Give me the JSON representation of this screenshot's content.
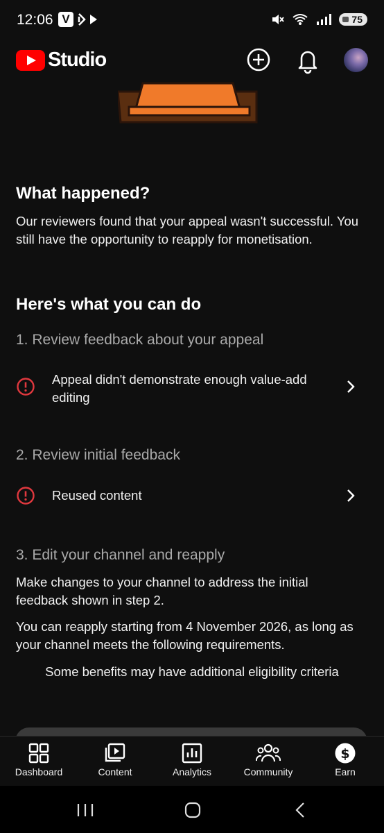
{
  "status_bar": {
    "time": "12:06",
    "battery": "75"
  },
  "app_bar": {
    "title": "Studio"
  },
  "what_happened": {
    "heading": "What happened?",
    "body": "Our reviewers found that your appeal wasn't successful. You still have the opportunity to reapply for monetisation."
  },
  "what_to_do": {
    "heading": "Here's what you can do",
    "step1": {
      "title": "1. Review feedback about your appeal",
      "item": "Appeal didn't demonstrate enough value-add editing"
    },
    "step2": {
      "title": "2. Review initial feedback",
      "item": "Reused content"
    },
    "step3": {
      "title": "3. Edit your channel and reapply",
      "para1": "Make changes to your channel to address the initial feedback shown in step 2.",
      "para2": "You can reapply starting from 4 November 2026, as long as your channel meets the following requirements.",
      "note": "Some benefits may have additional eligibility criteria"
    }
  },
  "bottom_nav": [
    {
      "label": "Dashboard",
      "icon": "dashboard-icon"
    },
    {
      "label": "Content",
      "icon": "content-icon"
    },
    {
      "label": "Analytics",
      "icon": "analytics-icon"
    },
    {
      "label": "Community",
      "icon": "community-icon"
    },
    {
      "label": "Earn",
      "icon": "earn-icon"
    }
  ],
  "colors": {
    "background": "#0f0f0f",
    "brand_red": "#ff0000",
    "alert_red": "#e0383e",
    "muted_text": "#aaaaaa"
  }
}
